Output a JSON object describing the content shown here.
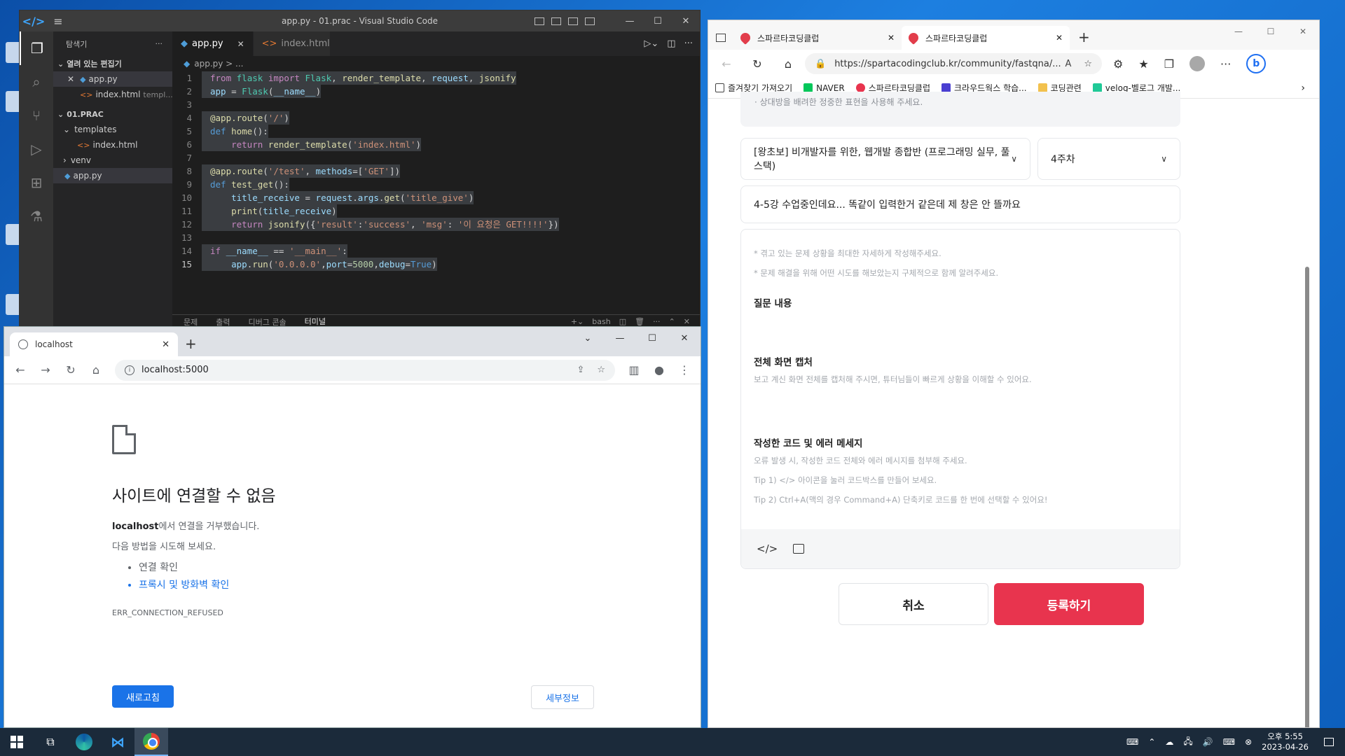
{
  "vscode": {
    "window_title": "app.py - 01.prac - Visual Studio Code",
    "explorer_title": "탐색기",
    "explorer_more": "···",
    "open_editors_label": "열려 있는 편집기",
    "open_editors": [
      {
        "name": "app.py",
        "detail": ""
      },
      {
        "name": "index.html",
        "detail": "templ..."
      }
    ],
    "folder_label": "01.PRAC",
    "tree": [
      {
        "name": "templates",
        "type": "folder"
      },
      {
        "name": "index.html",
        "type": "file"
      },
      {
        "name": "venv",
        "type": "folder"
      },
      {
        "name": "app.py",
        "type": "file"
      }
    ],
    "tabs": [
      {
        "label": "app.py",
        "active": true
      },
      {
        "label": "index.html",
        "active": false
      }
    ],
    "breadcrumb": "app.py > ...",
    "panel_tabs": [
      "문제",
      "출력",
      "디버그 콘솔",
      "터미널"
    ],
    "terminal_name": "bash",
    "code_lines": [
      "from flask import Flask, render_template, request, jsonify",
      "app = Flask(__name__)",
      "",
      "@app.route('/')",
      "def home():",
      "    return render_template('index.html')",
      "",
      "@app.route('/test', methods=['GET'])",
      "def test_get():",
      "    title_receive = request.args.get('title_give')",
      "    print(title_receive)",
      "    return jsonify({'result':'success', 'msg': '이 요청은 GET!!!!'})",
      "",
      "if __name__ == '__main__':",
      "    app.run('0.0.0.0',port=5000,debug=True)"
    ],
    "current_line": 15
  },
  "chrome": {
    "tab_title": "localhost",
    "address": "localhost:5000",
    "error_title": "사이트에 연결할 수 없음",
    "error_host": "localhost",
    "error_desc": "에서 연결을 거부했습니다.",
    "try_label": "다음 방법을 시도해 보세요.",
    "suggestions": [
      "연결 확인",
      "프록시 및 방화벽 확인"
    ],
    "error_code": "ERR_CONNECTION_REFUSED",
    "reload_label": "새로고침",
    "details_label": "세부정보"
  },
  "edge": {
    "tabs": [
      "스파르타코딩클럽",
      "스파르타코딩클럽"
    ],
    "url": "https://spartacodingclub.kr/community/fastqna/...",
    "bookmarks": [
      {
        "label": "즐겨찾기 가져오기",
        "color": "#444444"
      },
      {
        "label": "NAVER",
        "color": "#03c75a"
      },
      {
        "label": "스파르타코딩클럽",
        "color": "#e8344e"
      },
      {
        "label": "크라우드웍스 학습...",
        "color": "#4a3fd1"
      },
      {
        "label": "코딩관련",
        "color": "#f2c14e"
      },
      {
        "label": "velog-벨로그 개발...",
        "color": "#20c997"
      }
    ],
    "notice_text": "· 상대방을 배려한 정중한 표현을 사용해 주세요.",
    "course_select": "[왕초보] 비개발자를 위한, 웹개발 종합반 (프로그래밍 실무, 풀스택)",
    "week_select": "4주차",
    "question_title": "4-5강 수업중인데요... 똑같이 입력한거 같은데 제 창은 안  뜰까요",
    "hints": [
      "* 겪고 있는 문제 상황을 최대한 자세하게 작성해주세요.",
      "* 문제 해결을 위해 어떤 시도를 해보았는지 구체적으로 함께 알려주세요."
    ],
    "section_question": "질문 내용",
    "section_capture": "전체 화면 캡처",
    "capture_desc": "보고 계신 화면 전체를 캡처해 주시면, 튜터님들이 빠르게 상황을 이해할 수 있어요.",
    "section_code": "작성한 코드 및 에러 메세지",
    "code_desc": [
      "오류 발생 시, 작성한 코드 전체와 에러 메시지를 첨부해 주세요.",
      "Tip 1) </> 아이콘을 눌러 코드박스를 만들어 보세요.",
      "Tip 2) Ctrl+A(맥의 경우 Command+A) 단축키로 코드를 한 번에 선택할 수 있어요!"
    ],
    "code_button": "</>",
    "cancel_label": "취소",
    "submit_label": "등록하기",
    "accent_color": "#e8344e"
  },
  "taskbar": {
    "time": "오후 5:55",
    "date": "2023-04-26"
  }
}
